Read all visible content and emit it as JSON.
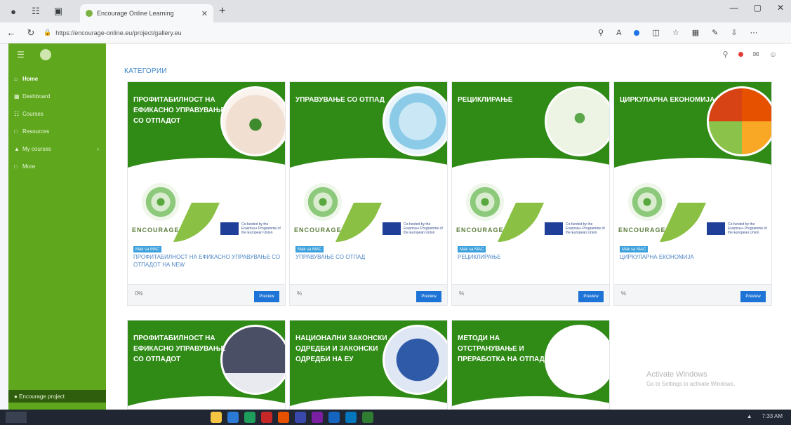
{
  "browser": {
    "tab_title": "Encourage Online Learning",
    "url": "https://encourage-online.eu/project/gallery.eu"
  },
  "sidebar": {
    "items": [
      {
        "label": "Home"
      },
      {
        "label": "Dashboard"
      },
      {
        "label": "Courses"
      },
      {
        "label": "Resources"
      },
      {
        "label": "My courses"
      },
      {
        "label": "More"
      }
    ],
    "footer_label": "Encourage project"
  },
  "main": {
    "section_title": "КАТЕГОРИИ",
    "cards": [
      {
        "banner_title": "ПРОФИТАБИЛНОСТ НА ЕФИКАСНО УПРАВУВАЊЕ СО ОТПАДОТ",
        "badge": "Mak sa MAC",
        "title": "ПРОФИТАБИЛНОСТ НА ЕФИКАСНО УПРАВУВАЊЕ СО ОТПАДОТ НА NEW",
        "footer_mark": "0%",
        "button": "Preview",
        "logo_text": "ENCOURAGE",
        "eu_text": "Co-funded by the Erasmus+ Programme of the European Union"
      },
      {
        "banner_title": "УПРАВУВАЊЕ СО ОТПАД",
        "badge": "Mak sa MAC",
        "title": "УПРАВУВАЊЕ СО ОТПАД",
        "footer_mark": "%",
        "button": "Preview",
        "logo_text": "ENCOURAGE",
        "eu_text": "Co-funded by the Erasmus+ Programme of the European Union"
      },
      {
        "banner_title": "РЕЦИКЛИРАЊЕ",
        "badge": "Mak sa MAC",
        "title": "РЕЦИКЛИРАЊЕ",
        "footer_mark": "%",
        "button": "Preview",
        "logo_text": "ENCOURAGE",
        "eu_text": "Co-funded by the Erasmus+ Programme of the European Union"
      },
      {
        "banner_title": "ЦИРКУЛАРНА ЕКОНОМИЈА",
        "badge": "Mak sa MAC",
        "title": "ЦИРКУЛАРНА ЕКОНОМИЈА",
        "footer_mark": "%",
        "button": "Preview",
        "logo_text": "ENCOURAGE",
        "eu_text": "Co-funded by the Erasmus+ Programme of the European Union"
      },
      {
        "banner_title": "ПРОФИТАБИЛНОСТ НА ЕФИКАСНО УПРАВУВАЊЕ СО ОТПАДОТ"
      },
      {
        "banner_title": "НАЦИОНАЛНИ ЗАКОНСКИ ОДРЕДБИ И ЗАКОНСКИ ОДРЕДБИ НА ЕУ"
      },
      {
        "banner_title": "МЕТОДИ НА ОТСТРАНУВАЊЕ И ПРЕРАБОТКА НА ОТПАДОТ"
      }
    ]
  },
  "watermark": {
    "line1": "Activate Windows",
    "line2": "Go to Settings to activate Windows."
  },
  "taskbar": {
    "time": "7:33 AM"
  },
  "colors": {
    "sidebar_green": "#5fa71c",
    "banner_green": "#2f8a16",
    "accent_blue": "#1e74d6",
    "link_blue": "#4f87c4"
  }
}
